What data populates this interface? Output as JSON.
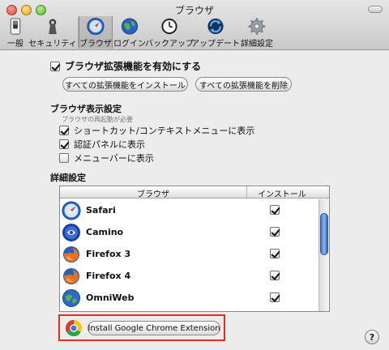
{
  "window": {
    "title": "ブラウザ"
  },
  "toolbar": {
    "items": [
      {
        "label": "一般",
        "icon": "switch-icon"
      },
      {
        "label": "セキュリティ",
        "icon": "keyhole-icon"
      },
      {
        "label": "ブラウザ",
        "icon": "compass-icon",
        "selected": true
      },
      {
        "label": "ログイン",
        "icon": "globe-icon"
      },
      {
        "label": "バックアップ",
        "icon": "clock-icon"
      },
      {
        "label": "アップデート",
        "icon": "sync-icon"
      },
      {
        "label": "詳細設定",
        "icon": "gear-icon"
      }
    ]
  },
  "extensions": {
    "enable_label": "ブラウザ拡張機能を有効にする",
    "enable_checked": true,
    "install_all_button": "すべての拡張機能をインストール",
    "remove_all_button": "すべての拡張機能を削除"
  },
  "display": {
    "title": "ブラウザ表示設定",
    "restart_note": "ブラウザの再起動が必要",
    "options": [
      {
        "label": "ショートカット/コンテキストメニューに表示",
        "checked": true
      },
      {
        "label": "認証パネルに表示",
        "checked": true
      },
      {
        "label": "メニューバーに表示",
        "checked": false
      }
    ]
  },
  "advanced": {
    "title": "詳細設定",
    "columns": {
      "browser": "ブラウザ",
      "install": "インストール"
    },
    "browsers": [
      {
        "name": "Safari",
        "icon": "safari-icon",
        "installed": true
      },
      {
        "name": "Camino",
        "icon": "camino-icon",
        "installed": true
      },
      {
        "name": "Firefox 3",
        "icon": "firefox-icon",
        "installed": true
      },
      {
        "name": "Firefox 4",
        "icon": "firefox-icon",
        "installed": true
      },
      {
        "name": "OmniWeb",
        "icon": "omniweb-icon",
        "installed": true
      }
    ]
  },
  "chrome": {
    "button_label": "Install Google Chrome Extension",
    "icon": "chrome-icon"
  },
  "help": {
    "label": "?"
  },
  "colors": {
    "highlight_border": "#e0301e",
    "scroll_thumb": "#3d73c8"
  }
}
